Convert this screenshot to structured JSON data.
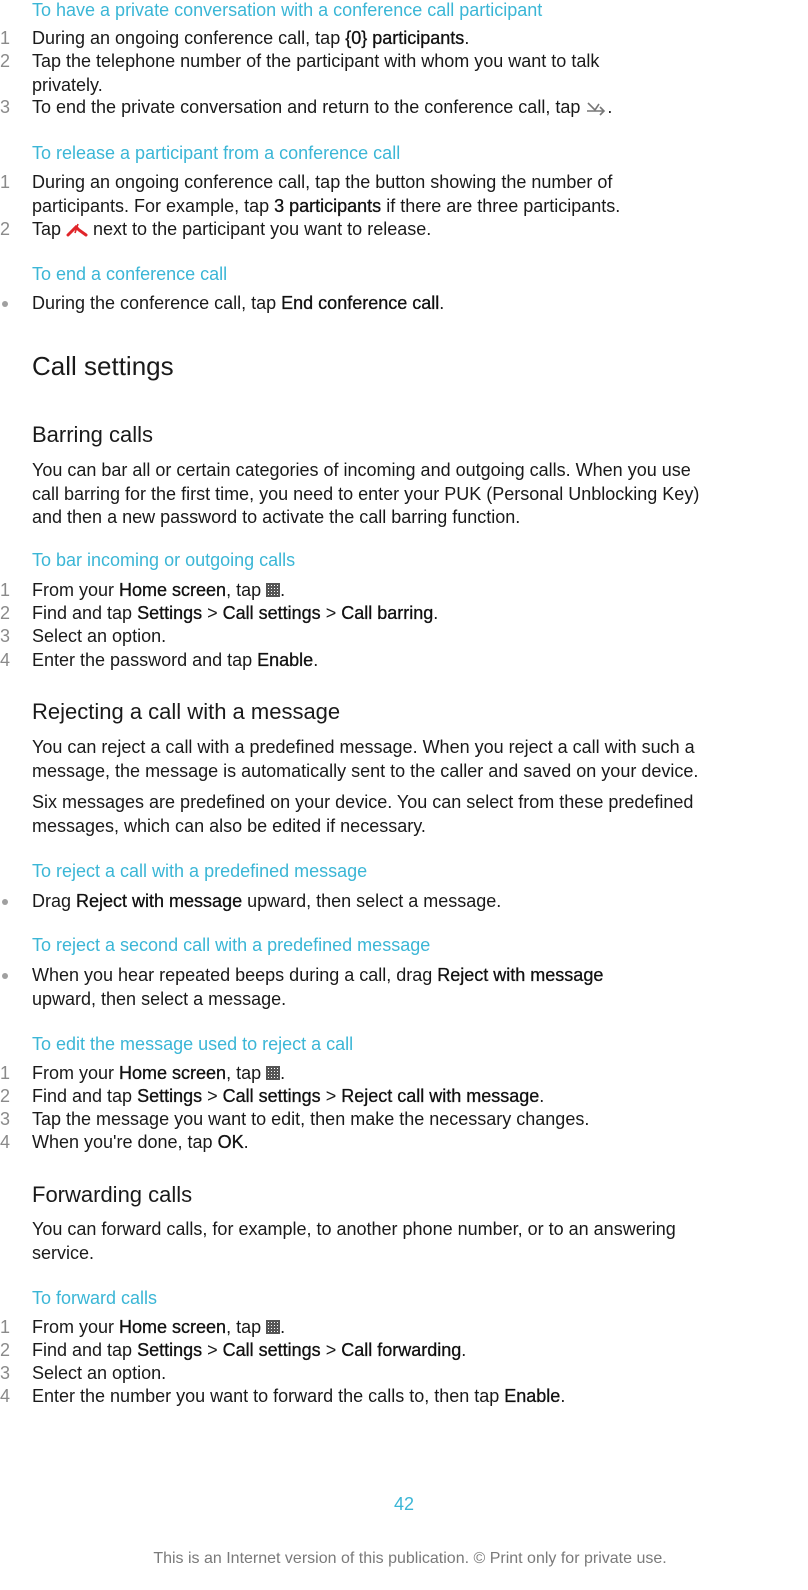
{
  "colors": {
    "accent": "#3bb6d6",
    "text": "#1a1a1a",
    "muted": "#8a8a8a",
    "end_call_red": "#e0252a"
  },
  "private_conversation": {
    "title": "To have a private conversation with a conference call participant",
    "steps": [
      {
        "num": "1",
        "pre": "During an ongoing conference call, tap ",
        "bold": "{0} participants",
        "post": "."
      },
      {
        "num": "2",
        "line1": "Tap the telephone number of the participant with whom you want to talk",
        "line2": "privately."
      },
      {
        "num": "3",
        "pre": "To end the private conversation and return to the conference call, tap ",
        "icon": "merge-call-icon",
        "post": "."
      }
    ]
  },
  "release_participant": {
    "title": "To release a participant from a conference call",
    "steps": [
      {
        "num": "1",
        "line1": "During an ongoing conference call, tap the button showing the number of",
        "line2_pre": "participants. For example, tap ",
        "line2_bold": "3 participants",
        "line2_post": " if there are three participants."
      },
      {
        "num": "2",
        "pre": "Tap ",
        "icon": "end-call-icon",
        "post": " next to the participant you want to release."
      }
    ]
  },
  "end_conference": {
    "title": "To end a conference call",
    "bullet": {
      "pre": "During the conference call, tap ",
      "bold": "End conference call",
      "post": "."
    }
  },
  "call_settings": {
    "heading": "Call settings"
  },
  "barring": {
    "heading": "Barring calls",
    "para_lines": [
      "You can bar all or certain categories of incoming and outgoing calls. When you use",
      "call barring for the first time, you need to enter your PUK (Personal Unblocking Key)",
      "and then a new password to activate the call barring function."
    ],
    "task_title": "To bar incoming or outgoing calls",
    "steps": [
      {
        "num": "1",
        "pre": "From your ",
        "bold": "Home screen",
        "mid": ", tap ",
        "icon": "app-grid-icon",
        "post": "."
      },
      {
        "num": "2",
        "pre": "Find and tap ",
        "b1": "Settings",
        "s1": " > ",
        "b2": "Call settings",
        "s2": " > ",
        "b3": "Call barring",
        "post": "."
      },
      {
        "num": "3",
        "text": "Select an option."
      },
      {
        "num": "4",
        "pre": "Enter the password and tap ",
        "bold": "Enable",
        "post": "."
      }
    ]
  },
  "rejecting": {
    "heading": "Rejecting a call with a message",
    "para1_lines": [
      "You can reject a call with a predefined message. When you reject a call with such a",
      "message, the message is automatically sent to the caller and saved on your device."
    ],
    "para2_lines": [
      "Six messages are predefined on your device. You can select from these predefined",
      "messages, which can also be edited if necessary."
    ],
    "task1_title": "To reject a call with a predefined message",
    "task1_bullet": {
      "pre": "Drag ",
      "bold": "Reject with message",
      "post": " upward, then select a message."
    },
    "task2_title": "To reject a second call with a predefined message",
    "task2_bullet": {
      "pre": "When you hear repeated beeps during a call, drag ",
      "bold": "Reject with message",
      "line2": "upward, then select a message."
    },
    "task3_title": "To edit the message used to reject a call",
    "task3_steps": [
      {
        "num": "1",
        "pre": "From your ",
        "bold": "Home screen",
        "mid": ", tap ",
        "icon": "app-grid-icon",
        "post": "."
      },
      {
        "num": "2",
        "pre": "Find and tap ",
        "b1": "Settings",
        "s1": " > ",
        "b2": "Call settings",
        "s2": " > ",
        "b3": "Reject call with message",
        "post": "."
      },
      {
        "num": "3",
        "text": "Tap the message you want to edit, then make the necessary changes."
      },
      {
        "num": "4",
        "pre": "When you're done, tap ",
        "bold": "OK",
        "post": "."
      }
    ]
  },
  "forwarding": {
    "heading": "Forwarding calls",
    "para_lines": [
      "You can forward calls, for example, to another phone number, or to an answering",
      "service."
    ],
    "task_title": "To forward calls",
    "steps": [
      {
        "num": "1",
        "pre": "From your ",
        "bold": "Home screen",
        "mid": ", tap ",
        "icon": "app-grid-icon",
        "post": "."
      },
      {
        "num": "2",
        "pre": "Find and tap ",
        "b1": "Settings",
        "s1": " > ",
        "b2": "Call settings",
        "s2": " > ",
        "b3": "Call forwarding",
        "post": "."
      },
      {
        "num": "3",
        "text": "Select an option."
      },
      {
        "num": "4",
        "pre": "Enter the number you want to forward the calls to, then tap ",
        "bold": "Enable",
        "post": "."
      }
    ]
  },
  "page_number": "42",
  "footer": "This is an Internet version of this publication. © Print only for private use."
}
